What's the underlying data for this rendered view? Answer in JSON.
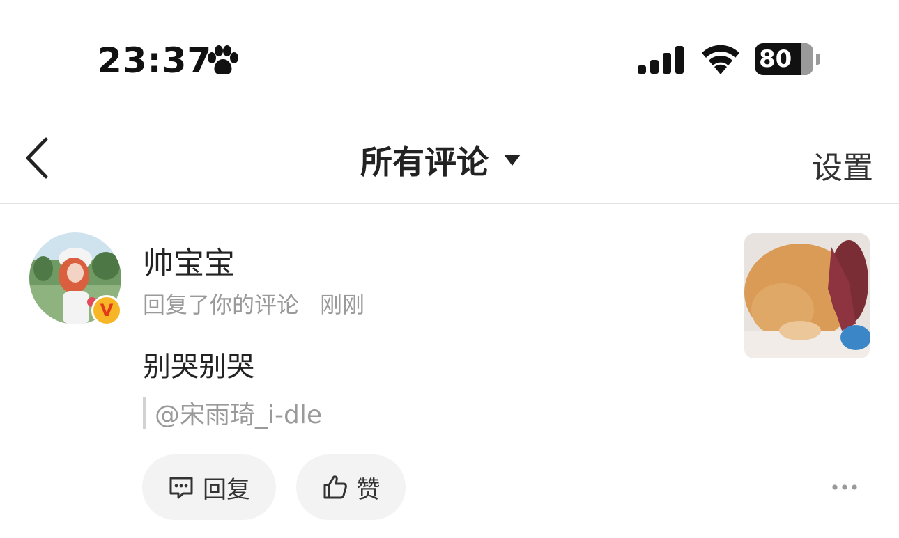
{
  "status_bar": {
    "time": "23:37",
    "battery": "80",
    "icons": [
      "paw-icon",
      "cellular-signal-icon",
      "wifi-icon",
      "battery-charging-icon"
    ]
  },
  "nav": {
    "title": "所有评论",
    "settings_label": "设置",
    "icons": [
      "back-chevron-icon",
      "caret-down-icon"
    ]
  },
  "comment": {
    "username": "帅宝宝",
    "action": "回复了你的评论",
    "time": "刚刚",
    "text": "别哭别哭",
    "quote": "@宋雨琦_i-dle",
    "badge": "V",
    "reply_label": "回复",
    "like_label": "赞",
    "icons": [
      "reply-icon",
      "thumbs-up-icon",
      "more-icon"
    ]
  },
  "colors": {
    "text_primary": "#222222",
    "text_secondary": "#9a9a9a",
    "button_bg": "#f3f3f3",
    "badge": "#f7b626"
  }
}
